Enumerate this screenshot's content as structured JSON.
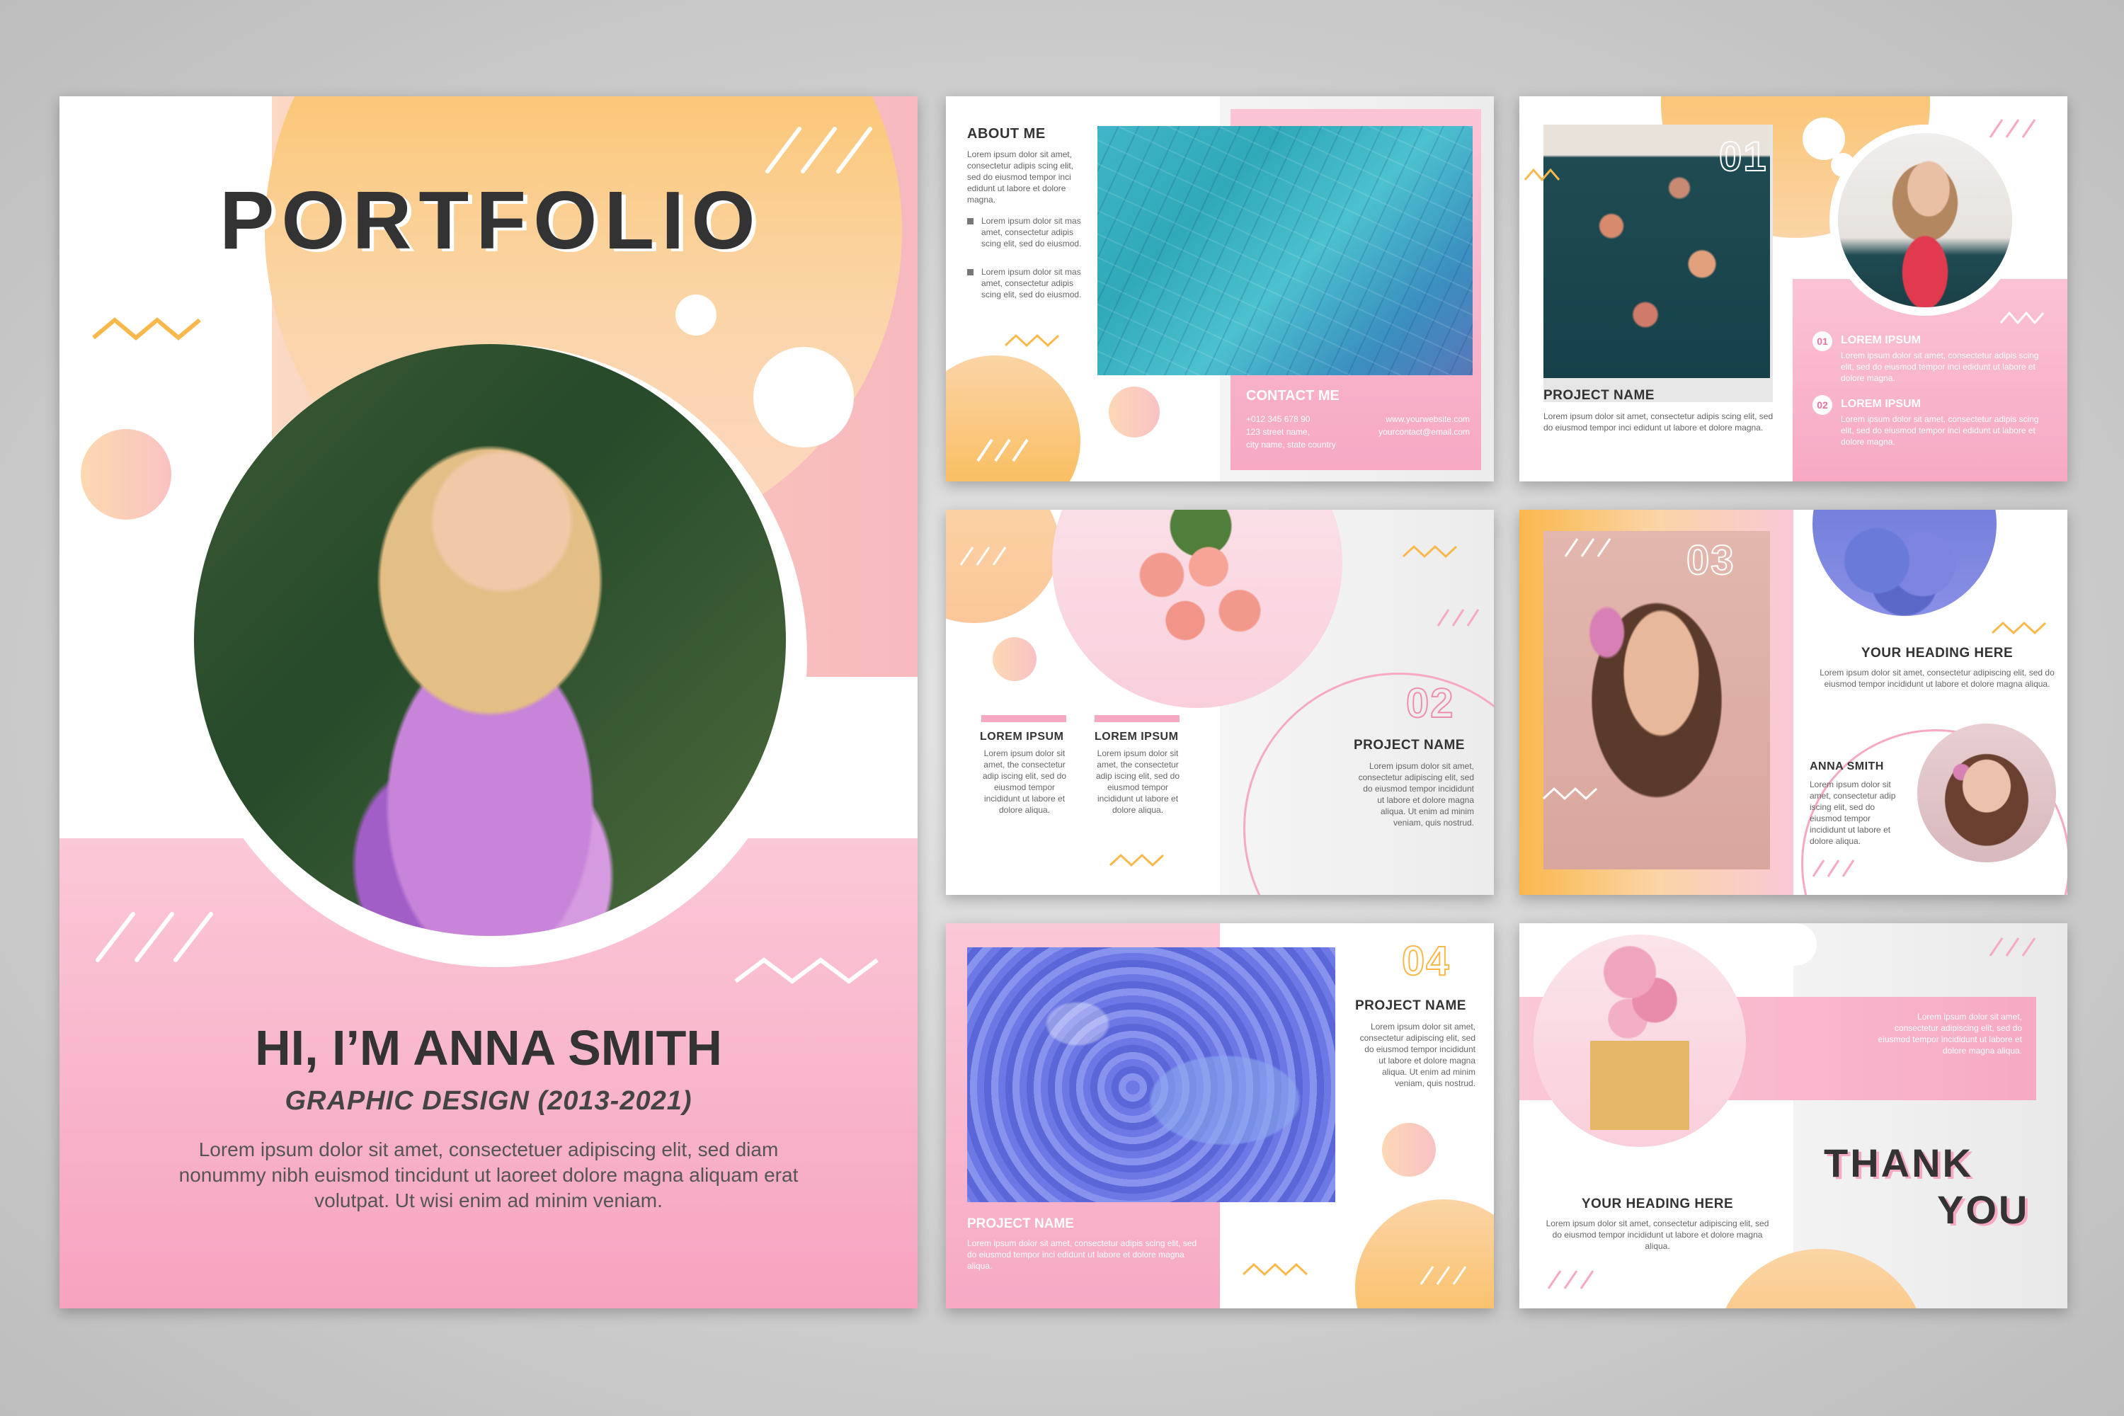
{
  "cover": {
    "title": "PORTFOLIO",
    "greeting": "HI, I’M ANNA SMITH",
    "subtitle": "GRAPHIC DESIGN (2013-2021)",
    "intro": "Lorem ipsum dolor sit amet, consectetuer adipiscing elit, sed diam nonummy nibh euismod tincidunt ut laoreet dolore magna aliquam erat volutpat. Ut wisi enim ad minim veniam."
  },
  "about": {
    "heading": "ABOUT ME",
    "paragraph": "Lorem ipsum dolor sit amet, consectetur adipis scing elit, sed do eiusmod tempor inci edidunt ut labore et dolore magna.",
    "bullets": [
      "Lorem ipsum dolor sit mas amet, consectetur adipis scing elit, sed do eiusmod.",
      "Lorem ipsum dolor sit mas amet, consectetur adipis scing elit, sed do eiusmod."
    ],
    "contact_heading": "CONTACT ME",
    "phone": "+012 345 678 90",
    "address_line1": "123 street name,",
    "address_line2": "city name, state country",
    "website": "www.yourwebsite.com",
    "email": "yourcontact@email.com"
  },
  "page01": {
    "number": "01",
    "project_name": "PROJECT NAME",
    "project_text": "Lorem ipsum dolor sit amet, consectetur adipis scing elit, sed do eiusmod tempor inci edidunt ut labore et dolore magna.",
    "items": [
      {
        "num": "01",
        "title": "LOREM IPSUM",
        "text": "Lorem ipsum dolor sit amet, consectetur adipis scing elit, sed do eiusmod tempor inci edidunt ut labore et dolore magna."
      },
      {
        "num": "02",
        "title": "LOREM IPSUM",
        "text": "Lorem ipsum dolor sit amet, consectetur adipis scing elit, sed do eiusmod tempor inci edidunt ut labore et dolore magna."
      }
    ]
  },
  "page02": {
    "number": "02",
    "col1_title": "LOREM IPSUM",
    "col2_title": "LOREM IPSUM",
    "col_text": "Lorem ipsum dolor sit amet, the consectetur adip iscing elit, sed do eiusmod tempor incididunt ut labore et dolore aliqua.",
    "project_name": "PROJECT NAME",
    "project_text": "Lorem ipsum dolor sit amet, consectetur adipiscing elit, sed do eiusmod tempor incididunt ut labore et dolore magna aliqua. Ut enim ad minim veniam, quis nostrud."
  },
  "page03": {
    "number": "03",
    "heading": "YOUR HEADING HERE",
    "heading_text": "Lorem ipsum dolor sit amet, consectetur adipiscing elit, sed do eiusmod tempor incididunt ut labore et dolore magna aliqua.",
    "name": "ANNA SMITH",
    "name_text": "Lorem ipsum dolor sit amet, consectetur adip iscing elit, sed do eiusmod tempor incididunt ut labore et dolore aliqua."
  },
  "page04": {
    "number": "04",
    "project_name": "PROJECT NAME",
    "project_text": "Lorem ipsum dolor sit amet, consectetur adipiscing elit, sed do eiusmod tempor incididunt ut labore et dolore magna aliqua. Ut enim ad minim veniam, quis nostrud.",
    "bottom_project": "PROJECT NAME",
    "bottom_text": "Lorem ipsum dolor sit amet, consectetur adipis scing elit, sed do eiusmod tempor inci edidunt ut labore et dolore magna aliqua."
  },
  "thanks": {
    "box_text": "Lorem ipsum dolor sit amet, consectetur adipiscing elit, sed do eiusmod tempor incididunt ut labore et dolore magna aliqua.",
    "heading": "YOUR HEADING HERE",
    "heading_text": "Lorem ipsum dolor sit amet, consectetur adipiscing elit, sed do eiusmod tempor incididunt ut labore et dolore magna aliqua.",
    "thank": "THANK",
    "you": "YOU"
  },
  "colors": {
    "pink": "#f7a9c4",
    "orange": "#f9b84c",
    "peach": "#fcd4b4"
  }
}
